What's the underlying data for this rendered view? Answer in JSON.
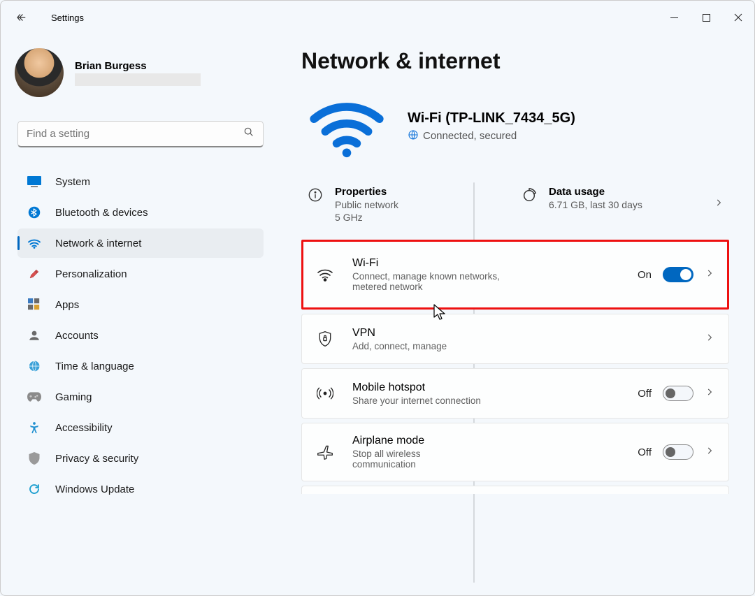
{
  "titlebar": {
    "app_title": "Settings"
  },
  "profile": {
    "name": "Brian Burgess"
  },
  "search": {
    "placeholder": "Find a setting"
  },
  "nav": {
    "items": [
      {
        "label": "System"
      },
      {
        "label": "Bluetooth & devices"
      },
      {
        "label": "Network & internet"
      },
      {
        "label": "Personalization"
      },
      {
        "label": "Apps"
      },
      {
        "label": "Accounts"
      },
      {
        "label": "Time & language"
      },
      {
        "label": "Gaming"
      },
      {
        "label": "Accessibility"
      },
      {
        "label": "Privacy & security"
      },
      {
        "label": "Windows Update"
      }
    ]
  },
  "page": {
    "title": "Network & internet",
    "status": {
      "ssid": "Wi-Fi (TP-LINK_7434_5G)",
      "connection_state": "Connected, secured"
    },
    "properties": {
      "title": "Properties",
      "sub1": "Public network",
      "sub2": "5 GHz"
    },
    "data_usage": {
      "title": "Data usage",
      "sub": "6.71 GB, last 30 days"
    },
    "cards": {
      "wifi": {
        "title": "Wi-Fi",
        "sub": "Connect, manage known networks, metered network",
        "state": "On"
      },
      "vpn": {
        "title": "VPN",
        "sub": "Add, connect, manage"
      },
      "hotspot": {
        "title": "Mobile hotspot",
        "sub": "Share your internet connection",
        "state": "Off"
      },
      "airplane": {
        "title": "Airplane mode",
        "sub": "Stop all wireless communication",
        "state": "Off"
      }
    }
  }
}
